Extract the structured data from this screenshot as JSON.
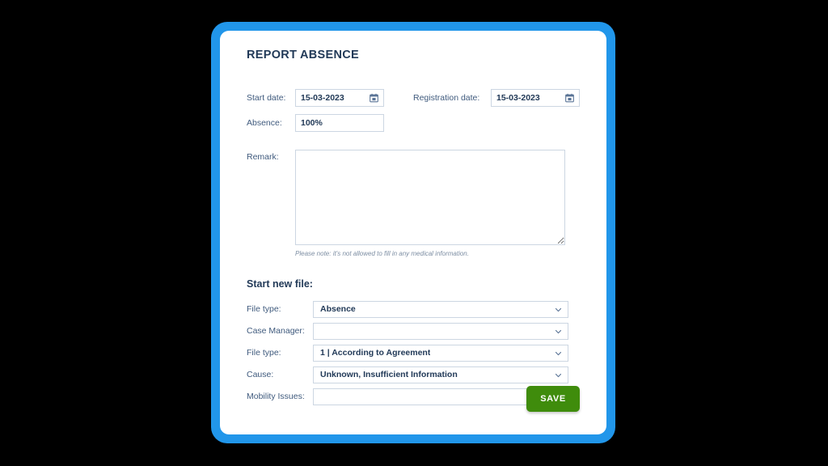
{
  "theme": {
    "frame_blue": "#2196ea",
    "card_white": "#ffffff",
    "text_navy": "#223a58",
    "label_slate": "#3f5a7d",
    "border_grey": "#ccd6e2",
    "save_green": "#3f8c0c",
    "backdrop_black": "#000000"
  },
  "header": {
    "title": "REPORT ABSENCE"
  },
  "top_form": {
    "start_date": {
      "label": "Start date:",
      "value": "15-03-2023",
      "icon": "calendar-icon"
    },
    "registration_date": {
      "label": "Registration date:",
      "value": "15-03-2023",
      "icon": "calendar-icon"
    },
    "absence": {
      "label": "Absence:",
      "value": "100%"
    }
  },
  "remark": {
    "label": "Remark:",
    "value": "",
    "placeholder": "",
    "note": "Please note: it's not allowed to fill in any medical information."
  },
  "new_file": {
    "section_title": "Start new file:",
    "fields": [
      {
        "label": "File type:",
        "value": "Absence",
        "icon": "chevron-down-icon",
        "name": "file-type-primary"
      },
      {
        "label": "Case Manager:",
        "value": "",
        "icon": "chevron-down-icon",
        "name": "case-manager"
      },
      {
        "label": "File type:",
        "value": "1 | According to Agreement",
        "icon": "chevron-down-icon",
        "name": "file-type-secondary"
      },
      {
        "label": "Cause:",
        "value": "Unknown, Insufficient Information",
        "icon": "chevron-down-icon",
        "name": "cause"
      },
      {
        "label": "Mobility Issues:",
        "value": "",
        "icon": "chevron-down-icon",
        "name": "mobility-issues"
      }
    ]
  },
  "actions": {
    "save_label": "SAVE"
  }
}
